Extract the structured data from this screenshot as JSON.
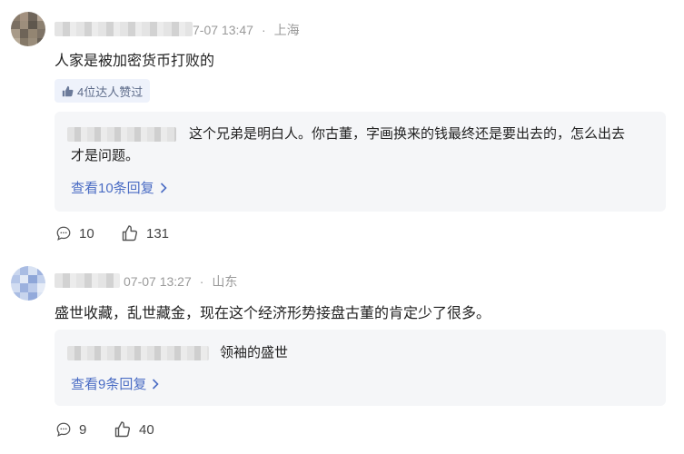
{
  "comments": [
    {
      "timestamp": "7-07 13:47",
      "location": "上海",
      "text": "人家是被加密货币打败的",
      "likes_badge": "4位达人赞过",
      "reply_line1": "这个兄弟是明白人。你古董，字画换来的钱最终还是要出去的，怎么出去",
      "reply_line2": "才是问题。",
      "view_replies": "查看10条回复",
      "comment_count": "10",
      "like_count": "131"
    },
    {
      "timestamp": "07-07 13:27",
      "location": "山东",
      "text": "盛世收藏，乱世藏金，现在这个经济形势接盘古董的肯定少了很多。",
      "reply_line1": "领袖的盛世",
      "view_replies": "查看9条回复",
      "comment_count": "9",
      "like_count": "40"
    }
  ],
  "separator_dot": "·",
  "colors": {
    "accent": "#4a6cc4",
    "meta": "#9a9a9a",
    "reply_bg": "#f5f6f8",
    "badge_bg": "#eef2fb"
  },
  "icons": [
    "thumbs-up-icon",
    "comment-icon",
    "like-icon",
    "chevron-right-icon"
  ]
}
